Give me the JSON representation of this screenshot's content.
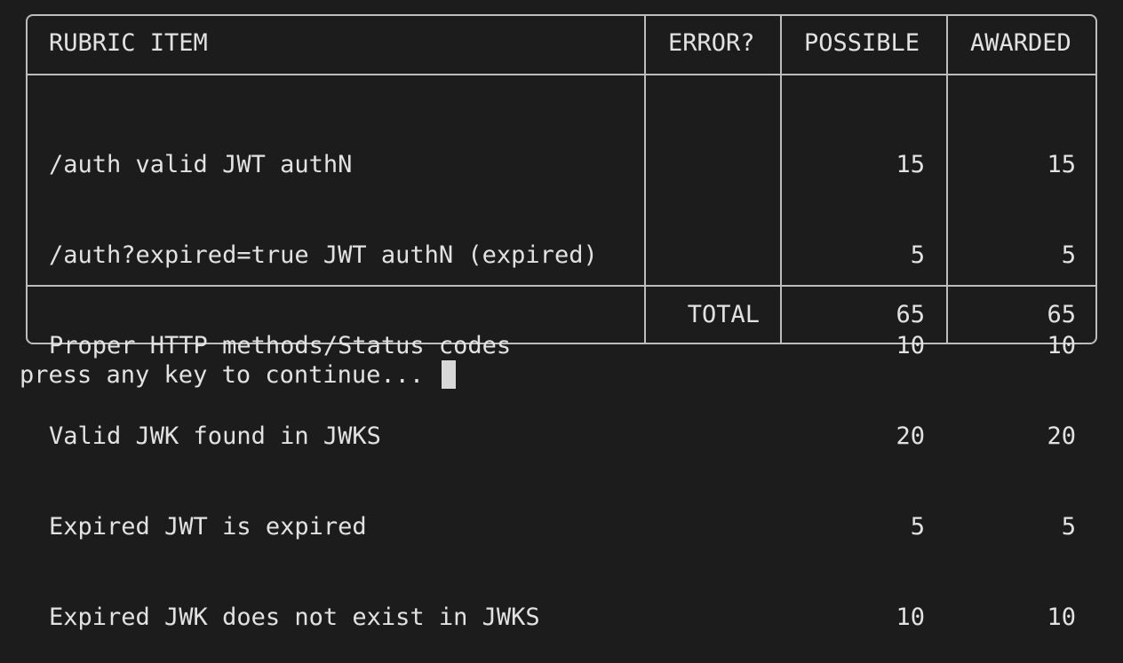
{
  "table": {
    "headers": {
      "item": "RUBRIC ITEM",
      "error": "ERROR?",
      "possible": "POSSIBLE",
      "awarded": "AWARDED"
    },
    "rows": [
      {
        "item": "/auth valid JWT authN",
        "error": "",
        "possible": "15",
        "awarded": "15"
      },
      {
        "item": "/auth?expired=true JWT authN (expired)",
        "error": "",
        "possible": "5",
        "awarded": "5"
      },
      {
        "item": "Proper HTTP methods/Status codes",
        "error": "",
        "possible": "10",
        "awarded": "10"
      },
      {
        "item": "Valid JWK found in JWKS",
        "error": "",
        "possible": "20",
        "awarded": "20"
      },
      {
        "item": "Expired JWT is expired",
        "error": "",
        "possible": "5",
        "awarded": "5"
      },
      {
        "item": "Expired JWK does not exist in JWKS",
        "error": "",
        "possible": "10",
        "awarded": "10"
      }
    ],
    "footer": {
      "label": "TOTAL",
      "possible": "65",
      "awarded": "65"
    }
  },
  "prompt": "press any key to continue..."
}
